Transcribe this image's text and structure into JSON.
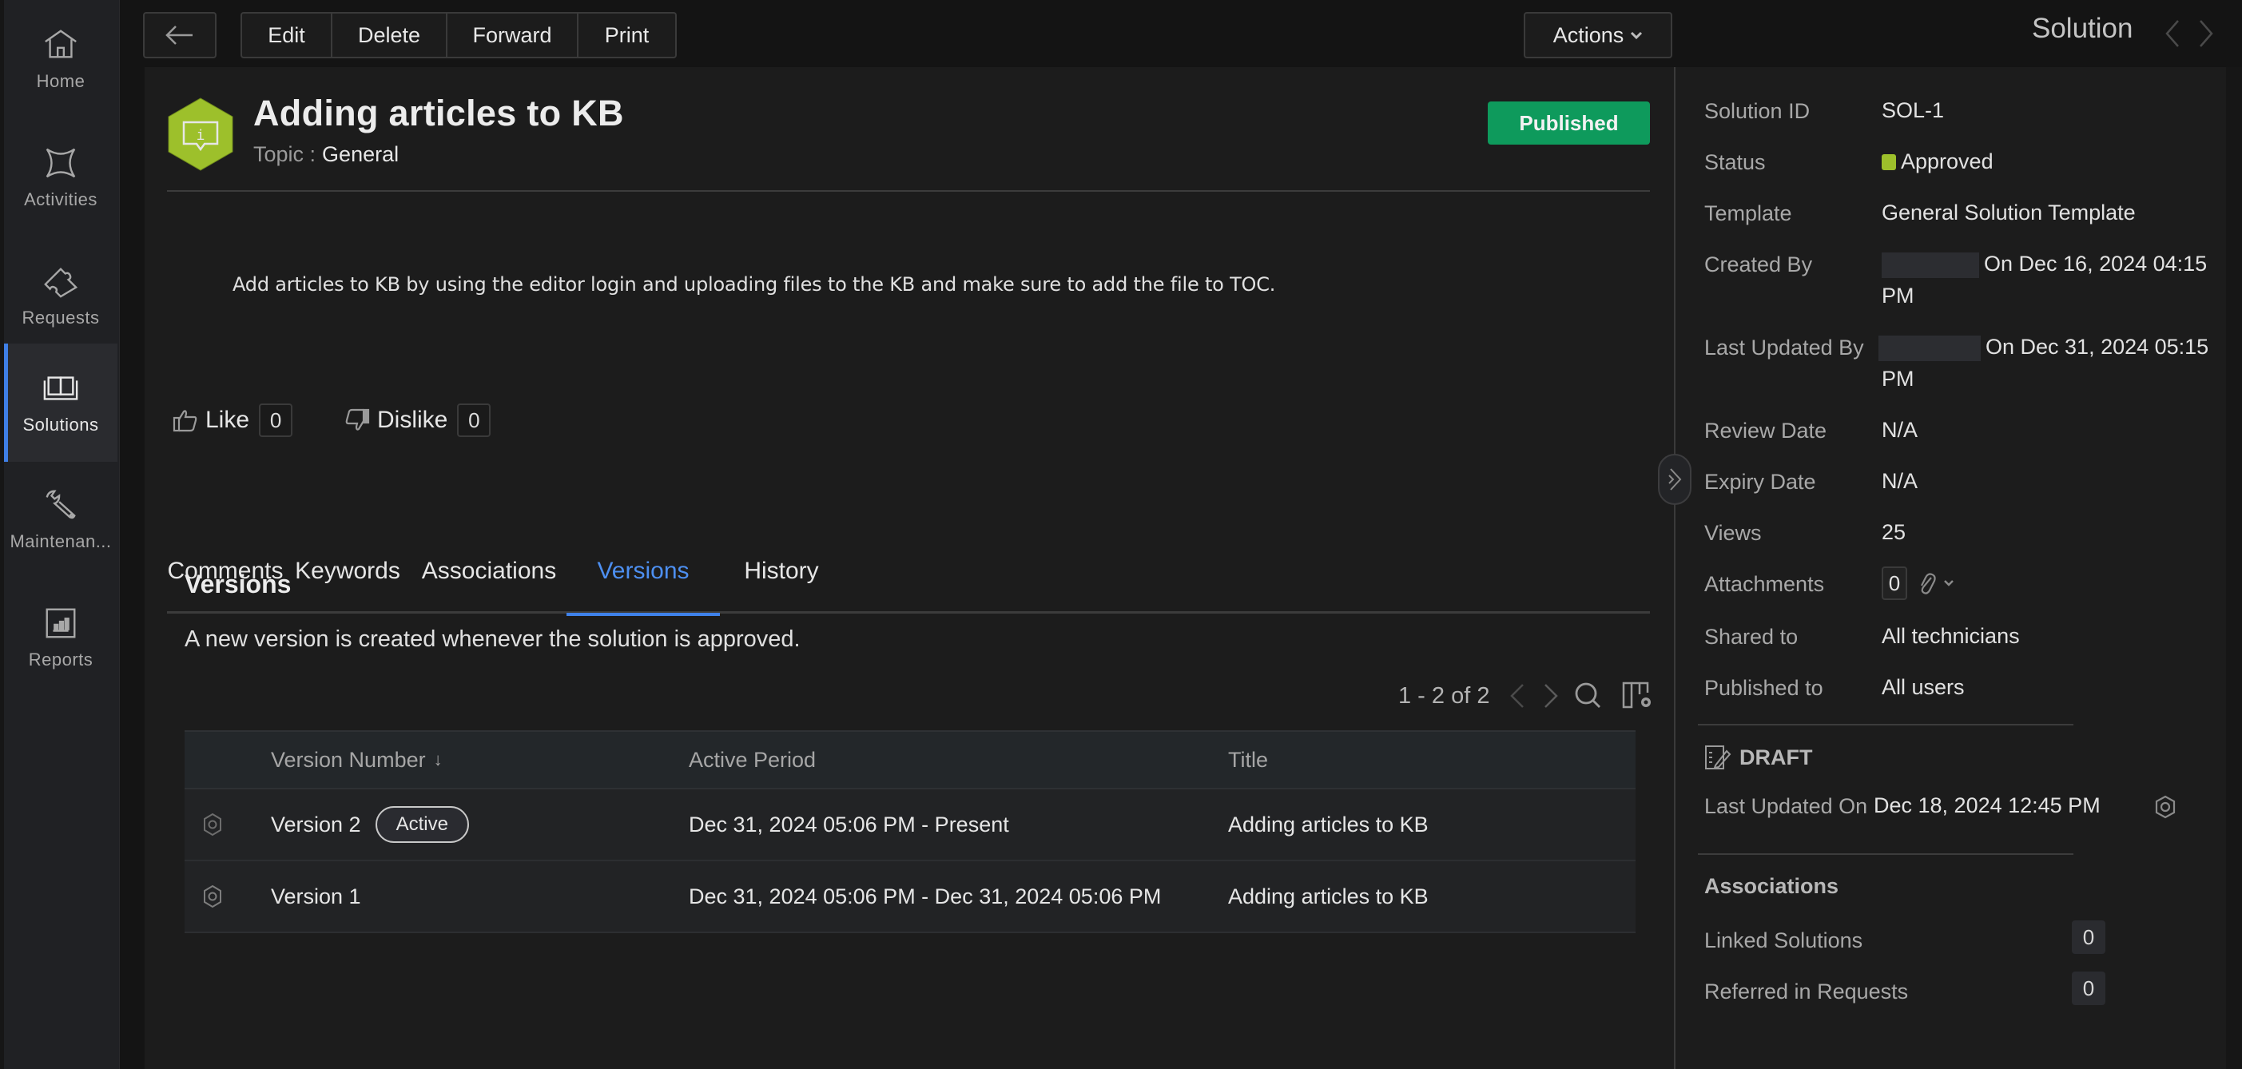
{
  "nav": {
    "items": [
      {
        "label": "Home",
        "icon": "home-icon",
        "active": false
      },
      {
        "label": "Activities",
        "icon": "activities-icon",
        "active": false
      },
      {
        "label": "Requests",
        "icon": "ticket-icon",
        "active": false
      },
      {
        "label": "Solutions",
        "icon": "book-icon",
        "active": true
      },
      {
        "label": "Maintenan...",
        "icon": "wrench-icon",
        "active": false
      },
      {
        "label": "Reports",
        "icon": "report-chart-icon",
        "active": false
      }
    ],
    "accent": "#3f7fe6"
  },
  "toolbar": {
    "back_icon": "arrow-left-icon",
    "edit": "Edit",
    "delete": "Delete",
    "forward": "Forward",
    "print": "Print",
    "actions": "Actions",
    "module_title": "Solution"
  },
  "solution": {
    "title": "Adding articles to KB",
    "topic_label": "Topic :",
    "topic_value": "General",
    "badge": "Published",
    "badge_color": "#0e9a5c",
    "description": "Add articles to KB by using the editor login and uploading files to the KB and make sure to add the file to TOC.",
    "like_label": "Like",
    "like_count": "0",
    "dislike_label": "Dislike",
    "dislike_count": "0"
  },
  "tabs": [
    {
      "label": "Comments",
      "active": false
    },
    {
      "label": "Keywords",
      "active": false
    },
    {
      "label": "Associations",
      "active": false
    },
    {
      "label": "Versions",
      "active": true
    },
    {
      "label": "History",
      "active": false
    }
  ],
  "versions": {
    "title": "Versions",
    "description": "A new version is created whenever the solution is approved.",
    "pager": "1 - 2 of 2",
    "columns": [
      "Version Number",
      "Active Period",
      "Title"
    ],
    "sort_indicator": "↓",
    "rows": [
      {
        "version": "Version 2",
        "badge": "Active",
        "period": "Dec 31, 2024 05:06 PM - Present",
        "title": "Adding articles to KB"
      },
      {
        "version": "Version 1",
        "badge": "",
        "period": "Dec 31, 2024 05:06 PM - Dec 31, 2024 05:06 PM",
        "title": "Adding articles to KB"
      }
    ]
  },
  "details": {
    "solution_id": {
      "label": "Solution ID",
      "value": "SOL-1"
    },
    "status": {
      "label": "Status",
      "value": "Approved",
      "color": "#9dc02b"
    },
    "template": {
      "label": "Template",
      "value": "General Solution Template"
    },
    "created_by": {
      "label": "Created By",
      "value_line1": "On Dec 16, 2024 04:15",
      "value_line2": "PM"
    },
    "last_updated_by": {
      "label": "Last Updated By",
      "value_line1": "On Dec 31, 2024 05:15",
      "value_line2": "PM"
    },
    "review_date": {
      "label": "Review Date",
      "value": "N/A"
    },
    "expiry_date": {
      "label": "Expiry Date",
      "value": "N/A"
    },
    "views": {
      "label": "Views",
      "value": "25"
    },
    "attachments": {
      "label": "Attachments",
      "value": "0"
    },
    "shared_to": {
      "label": "Shared to",
      "value": "All technicians"
    },
    "published_to": {
      "label": "Published to",
      "value": "All users"
    }
  },
  "draft": {
    "title": "DRAFT",
    "last_updated_label": "Last Updated On",
    "last_updated_value": "Dec 18, 2024 12:45 PM"
  },
  "associations": {
    "title": "Associations",
    "linked_label": "Linked Solutions",
    "linked_count": "0",
    "referred_label": "Referred in Requests",
    "referred_count": "0"
  }
}
